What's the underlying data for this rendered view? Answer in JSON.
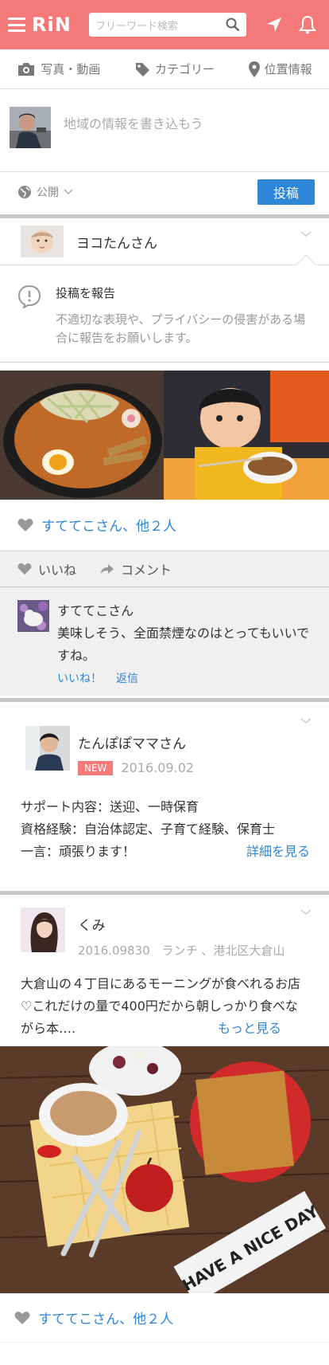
{
  "header": {
    "logo": "RiN",
    "search_placeholder": "フリーワード検索"
  },
  "options": {
    "photo": "写真・動画",
    "category": "カテゴリー",
    "location": "位置情報"
  },
  "compose": {
    "placeholder": "地域の情報を書き込もう",
    "visibility": "公開",
    "post": "投稿"
  },
  "post1": {
    "user": "ヨコたんさん",
    "report_title": "投稿を報告",
    "report_desc": "不適切な表現や、プライバシーの侵害がある場合に報告をお願いします。",
    "likes": "すててこさん、他２人",
    "like_action": "いいね",
    "comment_action": "コメント",
    "comment": {
      "name": "すててこさん",
      "text": "美味しそう、全面禁煙なのはとってもいいですね。",
      "like": "いいね！",
      "reply": "返信"
    }
  },
  "sitter": {
    "name": "たんぽぽママさん",
    "badge": "NEW",
    "date": "2016.09.02",
    "line1": "サポート内容：送迎、一時保育",
    "line2": "資格経験：自治体認定、子育て経験、保育士",
    "line3": "一言：頑張ります！",
    "more": "詳細を見る"
  },
  "post3": {
    "user": "くみ",
    "meta": "2016.09830　ランチ 、港北区大倉山",
    "text": "大倉山の４丁目にあるモーニングが食べれるお店♡これだけの量で400円だから朝しっかり食べながら本….",
    "more": "もっと見る",
    "likes": "すててこさん、他２人",
    "sign_text": "HAVE A NICE DAY"
  },
  "colors": {
    "brand": "#f47a79",
    "link": "#2e86d6"
  }
}
